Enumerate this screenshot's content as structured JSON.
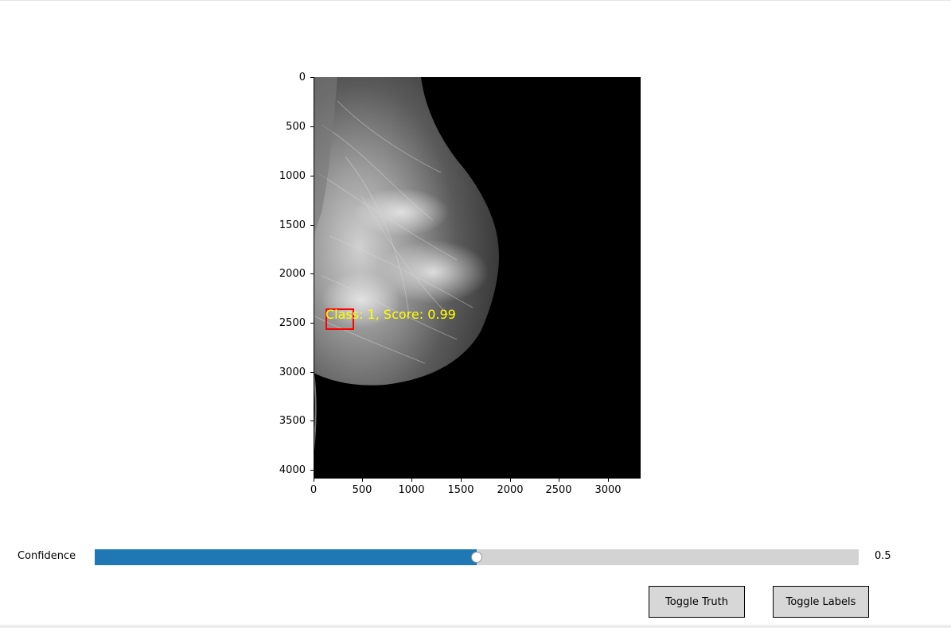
{
  "figure": {
    "y_ticks": [
      "0",
      "500",
      "1000",
      "1500",
      "2000",
      "2500",
      "3000",
      "3500",
      "4000"
    ],
    "x_ticks": [
      "0",
      "500",
      "1000",
      "1500",
      "2000",
      "2500",
      "3000"
    ],
    "detection": {
      "label": "Class: 1, Score: 0.99",
      "box_color": "#ff0000",
      "label_color": "#ffff00"
    }
  },
  "slider": {
    "label": "Confidence",
    "value_text": "0.5",
    "fraction": 0.5,
    "fill_color": "#1f77b4"
  },
  "buttons": {
    "toggle_truth": "Toggle Truth",
    "toggle_labels": "Toggle Labels"
  }
}
